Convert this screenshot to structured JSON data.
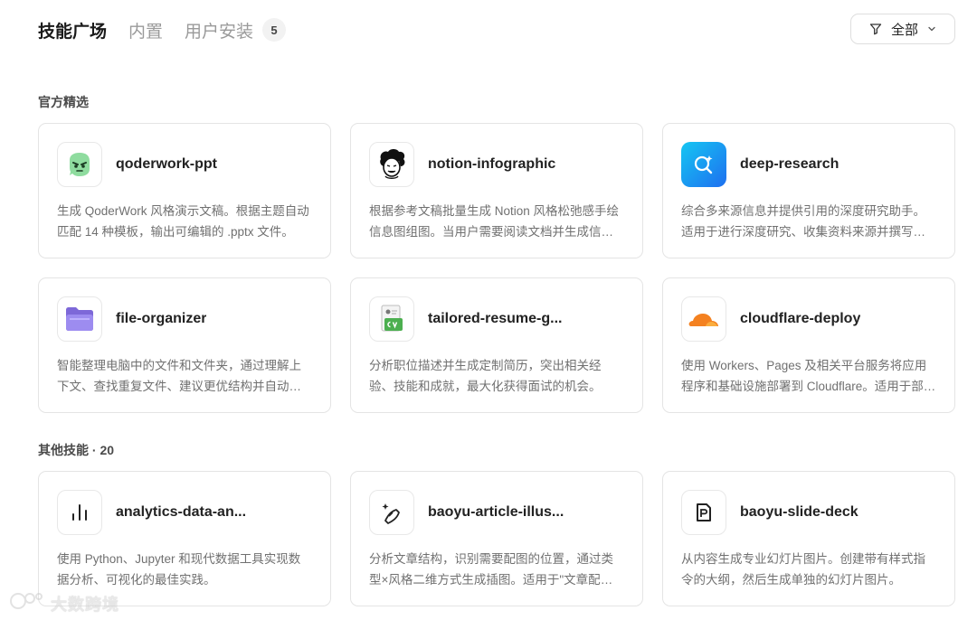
{
  "header": {
    "tabs": [
      {
        "label": "技能广场",
        "active": true
      },
      {
        "label": "内置",
        "active": false
      },
      {
        "label": "用户安装",
        "active": false,
        "count": "5"
      }
    ],
    "filter": {
      "label": "全部",
      "icon": "filter-icon",
      "chevron": "chevron-down-icon"
    }
  },
  "sections": {
    "official": {
      "title": "官方精选"
    },
    "others": {
      "title": "其他技能 · 20"
    }
  },
  "official_cards": [
    {
      "title": "qoderwork-ppt",
      "desc": "生成 QoderWork 风格演示文稿。根据主题自动匹配 14 种模板，输出可编辑的 .pptx 文件。",
      "icon": "qoder-mascot-icon"
    },
    {
      "title": "notion-infographic",
      "desc": "根据参考文稿批量生成 Notion 风格松弛感手绘信息图组图。当用户需要阅读文档并生成信息图时使用。",
      "icon": "sketch-avatar-icon"
    },
    {
      "title": "deep-research",
      "desc": "综合多来源信息并提供引用的深度研究助手。适用于进行深度研究、收集资料来源并撰写报告。",
      "icon": "search-sparkle-icon"
    },
    {
      "title": "file-organizer",
      "desc": "智能整理电脑中的文件和文件夹，通过理解上下文、查找重复文件、建议更优结构并自动执行整理。",
      "icon": "folder-icon"
    },
    {
      "title": "tailored-resume-g...",
      "desc": "分析职位描述并生成定制简历，突出相关经验、技能和成就，最大化获得面试的机会。",
      "icon": "cv-document-icon"
    },
    {
      "title": "cloudflare-deploy",
      "desc": "使用 Workers、Pages 及相关平台服务将应用程序和基础设施部署到 Cloudflare。适用于部署场景。",
      "icon": "cloudflare-icon"
    }
  ],
  "other_cards": [
    {
      "title": "analytics-data-an...",
      "desc": "使用 Python、Jupyter 和现代数据工具实现数据分析、可视化的最佳实践。",
      "icon": "bar-chart-icon"
    },
    {
      "title": "baoyu-article-illus...",
      "desc": "分析文章结构，识别需要配图的位置，通过类型×风格二维方式生成插图。适用于\"文章配图\"等场景。",
      "icon": "pen-sparkle-icon"
    },
    {
      "title": "baoyu-slide-deck",
      "desc": "从内容生成专业幻灯片图片。创建带有样式指令的大纲，然后生成单独的幻灯片图片。",
      "icon": "slide-doc-icon"
    }
  ],
  "watermark": {
    "text": "大数跨境"
  },
  "colors": {
    "accent_green": "#7ad08f",
    "folder_purple": "#8a78e0",
    "research_blue": "#1f8bf0",
    "cloudflare_orange": "#f48120",
    "cv_green": "#4caf50"
  }
}
